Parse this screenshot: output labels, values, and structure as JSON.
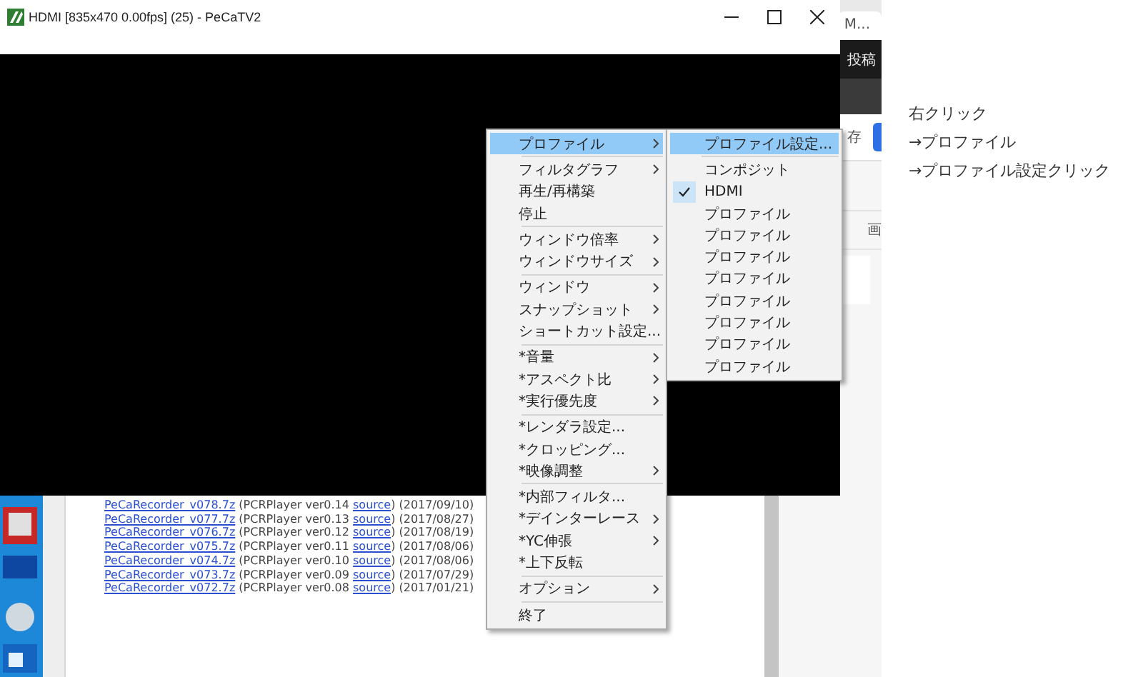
{
  "window": {
    "title": "HDMI [835x470 0.00fps] (25) - PeCaTV2"
  },
  "context_menu": {
    "items": [
      {
        "kind": "item",
        "label": "プロファイル",
        "submenu": true,
        "selected": true
      },
      {
        "kind": "separator"
      },
      {
        "kind": "item",
        "label": "フィルタグラフ",
        "submenu": true,
        "selected": false
      },
      {
        "kind": "item",
        "label": "再生/再構築",
        "submenu": false,
        "selected": false
      },
      {
        "kind": "item",
        "label": "停止",
        "submenu": false,
        "selected": false
      },
      {
        "kind": "separator"
      },
      {
        "kind": "item",
        "label": "ウィンドウ倍率",
        "submenu": true,
        "selected": false
      },
      {
        "kind": "item",
        "label": "ウィンドウサイズ",
        "submenu": true,
        "selected": false
      },
      {
        "kind": "separator"
      },
      {
        "kind": "item",
        "label": "ウィンドウ",
        "submenu": true,
        "selected": false
      },
      {
        "kind": "item",
        "label": "スナップショット",
        "submenu": true,
        "selected": false
      },
      {
        "kind": "item",
        "label": "ショートカット設定...",
        "submenu": false,
        "selected": false
      },
      {
        "kind": "separator"
      },
      {
        "kind": "item",
        "label": "*音量",
        "submenu": true,
        "selected": false
      },
      {
        "kind": "item",
        "label": "*アスペクト比",
        "submenu": true,
        "selected": false
      },
      {
        "kind": "item",
        "label": "*実行優先度",
        "submenu": true,
        "selected": false
      },
      {
        "kind": "separator"
      },
      {
        "kind": "item",
        "label": "*レンダラ設定...",
        "submenu": false,
        "selected": false
      },
      {
        "kind": "item",
        "label": "*クロッピング...",
        "submenu": false,
        "selected": false
      },
      {
        "kind": "item",
        "label": "*映像調整",
        "submenu": true,
        "selected": false
      },
      {
        "kind": "separator"
      },
      {
        "kind": "item",
        "label": "*内部フィルタ...",
        "submenu": false,
        "selected": false
      },
      {
        "kind": "item",
        "label": "*デインターレース",
        "submenu": true,
        "selected": false
      },
      {
        "kind": "item",
        "label": "*YC伸張",
        "submenu": true,
        "selected": false
      },
      {
        "kind": "item",
        "label": "*上下反転",
        "submenu": false,
        "selected": false
      },
      {
        "kind": "separator"
      },
      {
        "kind": "item",
        "label": "オプション",
        "submenu": true,
        "selected": false
      },
      {
        "kind": "separator"
      },
      {
        "kind": "item",
        "label": "終了",
        "submenu": false,
        "selected": false
      }
    ]
  },
  "submenu": {
    "items": [
      {
        "kind": "item",
        "label": "プロファイル設定...",
        "checked": false,
        "selected": true
      },
      {
        "kind": "separator"
      },
      {
        "kind": "item",
        "label": "コンポジット",
        "checked": false,
        "selected": false
      },
      {
        "kind": "item",
        "label": "HDMI",
        "checked": true,
        "selected": false
      },
      {
        "kind": "item",
        "label": "プロファイル",
        "checked": false,
        "selected": false
      },
      {
        "kind": "item",
        "label": "プロファイル",
        "checked": false,
        "selected": false
      },
      {
        "kind": "item",
        "label": "プロファイル",
        "checked": false,
        "selected": false
      },
      {
        "kind": "item",
        "label": "プロファイル",
        "checked": false,
        "selected": false
      },
      {
        "kind": "item",
        "label": "プロファイル",
        "checked": false,
        "selected": false
      },
      {
        "kind": "item",
        "label": "プロファイル",
        "checked": false,
        "selected": false
      },
      {
        "kind": "item",
        "label": "プロファイル",
        "checked": false,
        "selected": false
      },
      {
        "kind": "item",
        "label": "プロファイル",
        "checked": false,
        "selected": false
      }
    ]
  },
  "background_page": {
    "downloads": [
      {
        "file": "PeCaRecorder_v078.7z",
        "info": "(PCRPlayer ver0.14",
        "link": "source",
        "tail": ") (2017/09/10)"
      },
      {
        "file": "PeCaRecorder_v077.7z",
        "info": "(PCRPlayer ver0.13",
        "link": "source",
        "tail": ") (2017/08/27)"
      },
      {
        "file": "PeCaRecorder_v076.7z",
        "info": "(PCRPlayer ver0.12",
        "link": "source",
        "tail": ") (2017/08/19)"
      },
      {
        "file": "PeCaRecorder_v075.7z",
        "info": "(PCRPlayer ver0.11",
        "link": "source",
        "tail": ") (2017/08/06)"
      },
      {
        "file": "PeCaRecorder_v074.7z",
        "info": "(PCRPlayer ver0.10",
        "link": "source",
        "tail": ") (2017/08/06)"
      },
      {
        "file": "PeCaRecorder_v073.7z",
        "info": "(PCRPlayer ver0.09",
        "link": "source",
        "tail": ") (2017/07/29)"
      },
      {
        "file": "PeCaRecorder_v072.7z",
        "info": "(PCRPlayer ver0.08",
        "link": "source",
        "tail": ") (2017/01/21)"
      }
    ],
    "side": {
      "tab": "M...",
      "nav": "投稿",
      "button_label": "存",
      "tab_label": "画"
    }
  },
  "instructions": [
    "右クリック",
    "→プロファイル",
    "→プロファイル設定クリック"
  ]
}
